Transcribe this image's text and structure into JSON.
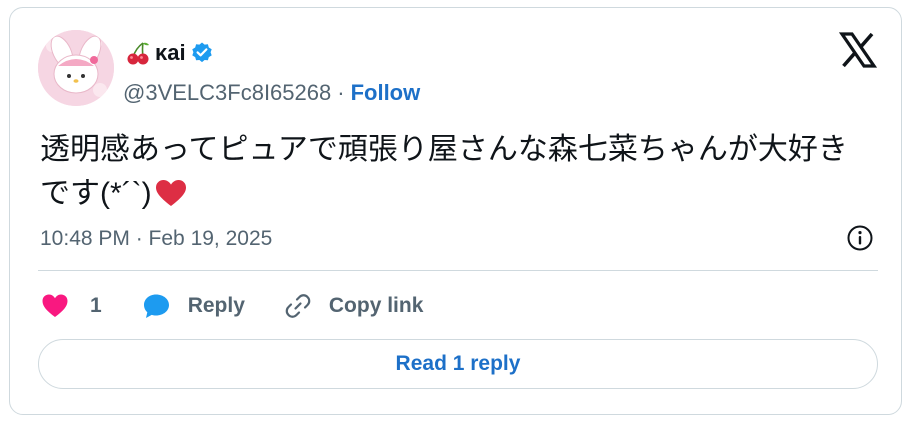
{
  "author": {
    "display_name": "κai",
    "handle": "@3VELC3Fc8I65268",
    "separator": "·",
    "follow_label": "Follow",
    "verified": true
  },
  "tweet": {
    "text": "透明感あってピュアで頑張り屋さんな森七菜ちゃんが大好きです(*´`)",
    "timestamp": "10:48 PM · Feb 19, 2025"
  },
  "actions": {
    "like_count": "1",
    "reply_label": "Reply",
    "copy_link_label": "Copy link"
  },
  "read_replies_label": "Read 1 reply",
  "colors": {
    "link_blue": "#1d70c8",
    "verified_blue": "#1d9bf0",
    "like_pink": "#f91880",
    "emoji_red": "#dd2e44",
    "muted": "#536471",
    "text": "#0f1419",
    "border": "#cfd9de"
  },
  "icons": [
    "cherry-emoji-icon",
    "verified-badge-icon",
    "x-logo-icon",
    "heart-emoji-icon",
    "info-icon",
    "like-heart-icon",
    "reply-bubble-icon",
    "copy-link-icon"
  ]
}
